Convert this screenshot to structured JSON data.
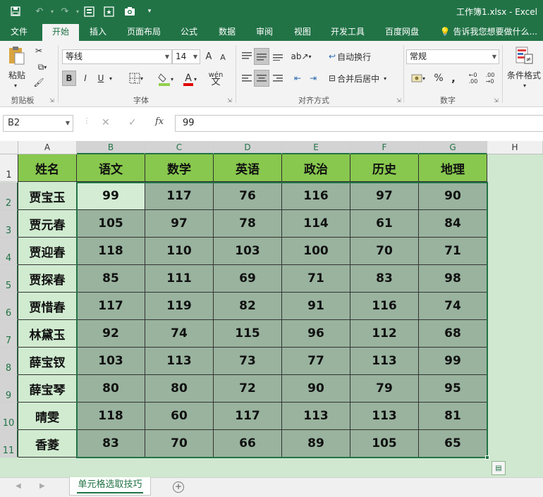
{
  "window": {
    "title": "工作簿1.xlsx - Excel"
  },
  "tabs": [
    "文件",
    "开始",
    "插入",
    "页面布局",
    "公式",
    "数据",
    "审阅",
    "视图",
    "开发工具",
    "百度网盘"
  ],
  "active_tab": "开始",
  "tell_me": "告诉我您想要做什么...",
  "ribbon": {
    "clipboard": {
      "paste": "粘贴",
      "label": "剪贴板"
    },
    "font": {
      "name": "等线",
      "size": "14",
      "bold": "B",
      "italic": "I",
      "underline": "U",
      "label": "字体",
      "grow": "A",
      "shrink": "A",
      "phonetic": "wén"
    },
    "alignment": {
      "wrap": "自动换行",
      "merge": "合并后居中",
      "label": "对齐方式"
    },
    "number": {
      "format": "常规",
      "percent": "%",
      "comma": ",",
      "label": "数字"
    },
    "styles": {
      "conditional": "条件格式"
    }
  },
  "formula_bar": {
    "name_box": "B2",
    "cancel": "✕",
    "enter": "✓",
    "fx": "fx",
    "content": "99"
  },
  "sheet": {
    "columns": [
      "A",
      "B",
      "C",
      "D",
      "E",
      "F",
      "G",
      "H"
    ],
    "rows": [
      "1",
      "2",
      "3",
      "4",
      "5",
      "6",
      "7",
      "8",
      "9",
      "10",
      "11"
    ],
    "header": [
      "姓名",
      "语文",
      "数学",
      "英语",
      "政治",
      "历史",
      "地理"
    ],
    "data": [
      [
        "贾宝玉",
        "99",
        "117",
        "76",
        "116",
        "97",
        "90"
      ],
      [
        "贾元春",
        "105",
        "97",
        "78",
        "114",
        "61",
        "84"
      ],
      [
        "贾迎春",
        "118",
        "110",
        "103",
        "100",
        "70",
        "71"
      ],
      [
        "贾探春",
        "85",
        "111",
        "69",
        "71",
        "83",
        "98"
      ],
      [
        "贾惜春",
        "117",
        "119",
        "82",
        "91",
        "116",
        "74"
      ],
      [
        "林黛玉",
        "92",
        "74",
        "115",
        "96",
        "112",
        "68"
      ],
      [
        "薛宝钗",
        "103",
        "113",
        "73",
        "77",
        "113",
        "99"
      ],
      [
        "薛宝琴",
        "80",
        "80",
        "72",
        "90",
        "79",
        "95"
      ],
      [
        "晴雯",
        "118",
        "60",
        "117",
        "113",
        "113",
        "81"
      ],
      [
        "香菱",
        "83",
        "70",
        "66",
        "89",
        "105",
        "65"
      ]
    ],
    "active_cell": "B2"
  },
  "sheet_tabs": {
    "active": "单元格选取技巧"
  },
  "colors": {
    "excel_green": "#217346",
    "header_fill": "#88c84e",
    "name_fill": "#d0ebd0",
    "data_fill": "#99b39e"
  }
}
